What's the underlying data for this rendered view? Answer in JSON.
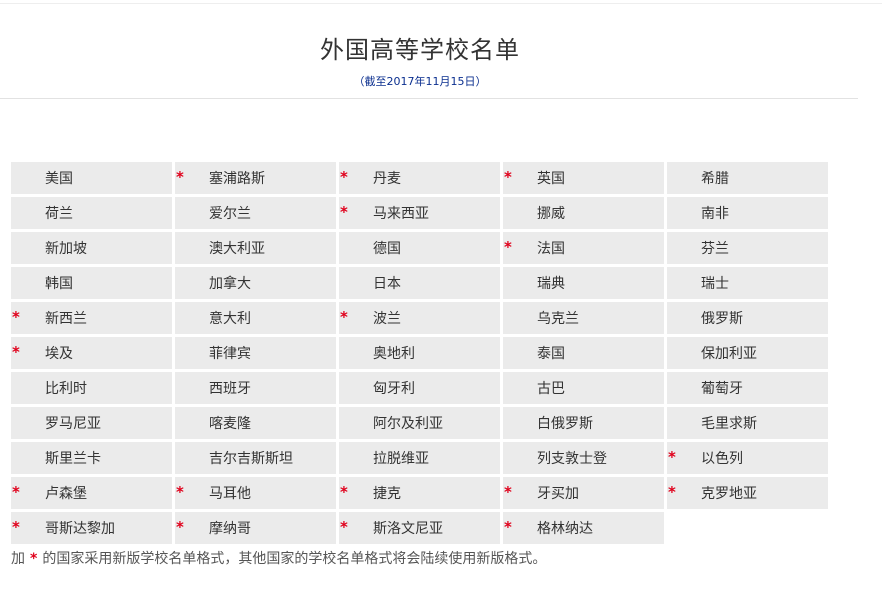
{
  "header": {
    "title": "外国高等学校名单",
    "subtitle": "（截至2017年11月15日）"
  },
  "star_symbol": "*",
  "countries": [
    {
      "name": "美国",
      "marked": false
    },
    {
      "name": "塞浦路斯",
      "marked": true
    },
    {
      "name": "丹麦",
      "marked": true
    },
    {
      "name": "英国",
      "marked": true
    },
    {
      "name": "希腊",
      "marked": false
    },
    {
      "name": "荷兰",
      "marked": false
    },
    {
      "name": "爱尔兰",
      "marked": false
    },
    {
      "name": "马来西亚",
      "marked": true
    },
    {
      "name": "挪威",
      "marked": false
    },
    {
      "name": "南非",
      "marked": false
    },
    {
      "name": "新加坡",
      "marked": false
    },
    {
      "name": "澳大利亚",
      "marked": false
    },
    {
      "name": "德国",
      "marked": false
    },
    {
      "name": "法国",
      "marked": true
    },
    {
      "name": "芬兰",
      "marked": false
    },
    {
      "name": "韩国",
      "marked": false
    },
    {
      "name": "加拿大",
      "marked": false
    },
    {
      "name": "日本",
      "marked": false
    },
    {
      "name": "瑞典",
      "marked": false
    },
    {
      "name": "瑞士",
      "marked": false
    },
    {
      "name": "新西兰",
      "marked": true
    },
    {
      "name": "意大利",
      "marked": false
    },
    {
      "name": "波兰",
      "marked": true
    },
    {
      "name": "乌克兰",
      "marked": false
    },
    {
      "name": "俄罗斯",
      "marked": false
    },
    {
      "name": "埃及",
      "marked": true
    },
    {
      "name": "菲律宾",
      "marked": false
    },
    {
      "name": "奥地利",
      "marked": false
    },
    {
      "name": "泰国",
      "marked": false
    },
    {
      "name": "保加利亚",
      "marked": false
    },
    {
      "name": "比利时",
      "marked": false
    },
    {
      "name": "西班牙",
      "marked": false
    },
    {
      "name": "匈牙利",
      "marked": false
    },
    {
      "name": "古巴",
      "marked": false
    },
    {
      "name": "葡萄牙",
      "marked": false
    },
    {
      "name": "罗马尼亚",
      "marked": false
    },
    {
      "name": "喀麦隆",
      "marked": false
    },
    {
      "name": "阿尔及利亚",
      "marked": false
    },
    {
      "name": "白俄罗斯",
      "marked": false
    },
    {
      "name": "毛里求斯",
      "marked": false
    },
    {
      "name": "斯里兰卡",
      "marked": false
    },
    {
      "name": "吉尔吉斯斯坦",
      "marked": false
    },
    {
      "name": "拉脱维亚",
      "marked": false
    },
    {
      "name": "列支敦士登",
      "marked": false
    },
    {
      "name": "以色列",
      "marked": true
    },
    {
      "name": "卢森堡",
      "marked": true
    },
    {
      "name": "马耳他",
      "marked": true
    },
    {
      "name": "捷克",
      "marked": true
    },
    {
      "name": "牙买加",
      "marked": true
    },
    {
      "name": "克罗地亚",
      "marked": true
    },
    {
      "name": "哥斯达黎加",
      "marked": true
    },
    {
      "name": "摩纳哥",
      "marked": true
    },
    {
      "name": "斯洛文尼亚",
      "marked": true
    },
    {
      "name": "格林纳达",
      "marked": true
    }
  ],
  "note": {
    "prefix": "加",
    "suffix": "的国家采用新版学校名单格式，其他国家的学校名单格式将会陆续使用新版格式。"
  },
  "colors": {
    "star": "#e0001b",
    "subtitle": "#0b2f8f",
    "cell_bg": "#ebebeb"
  }
}
